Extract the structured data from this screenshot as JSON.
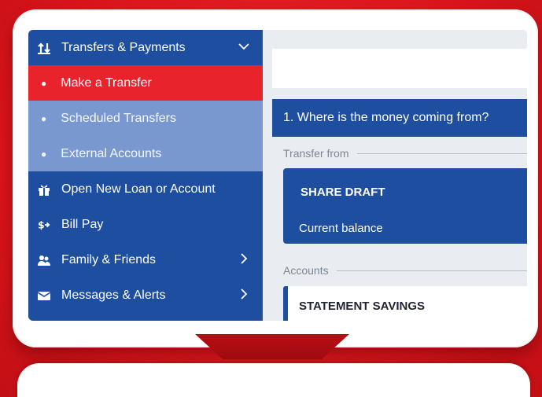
{
  "sidebar": {
    "items": [
      {
        "label": "Transfers & Payments",
        "icon": "transfer-arrows-icon",
        "chevron": "chevron-down-icon"
      },
      {
        "label": "Make a Transfer",
        "active": true
      },
      {
        "label": "Scheduled Transfers"
      },
      {
        "label": "External Accounts"
      },
      {
        "label": "Open New Loan or Account",
        "icon": "gift-icon"
      },
      {
        "label": "Bill Pay",
        "icon": "dollar-arrow-icon"
      },
      {
        "label": "Family & Friends",
        "icon": "people-icon",
        "chevron": "chevron-right-icon"
      },
      {
        "label": "Messages & Alerts",
        "icon": "envelope-icon",
        "chevron": "chevron-right-icon"
      }
    ]
  },
  "main": {
    "step_title": "1. Where is the money coming from?",
    "transfer_from_label": "Transfer from",
    "selected_account": {
      "name": "SHARE DRAFT",
      "balance_label": "Current balance"
    },
    "accounts_label": "Accounts",
    "accounts": [
      {
        "name": "STATEMENT SAVINGS"
      }
    ]
  },
  "colors": {
    "background_red": "#e31b23",
    "brand_blue": "#1d4ea0",
    "sub_nav_blue": "#7a98d0",
    "active_red": "#e8232b"
  }
}
